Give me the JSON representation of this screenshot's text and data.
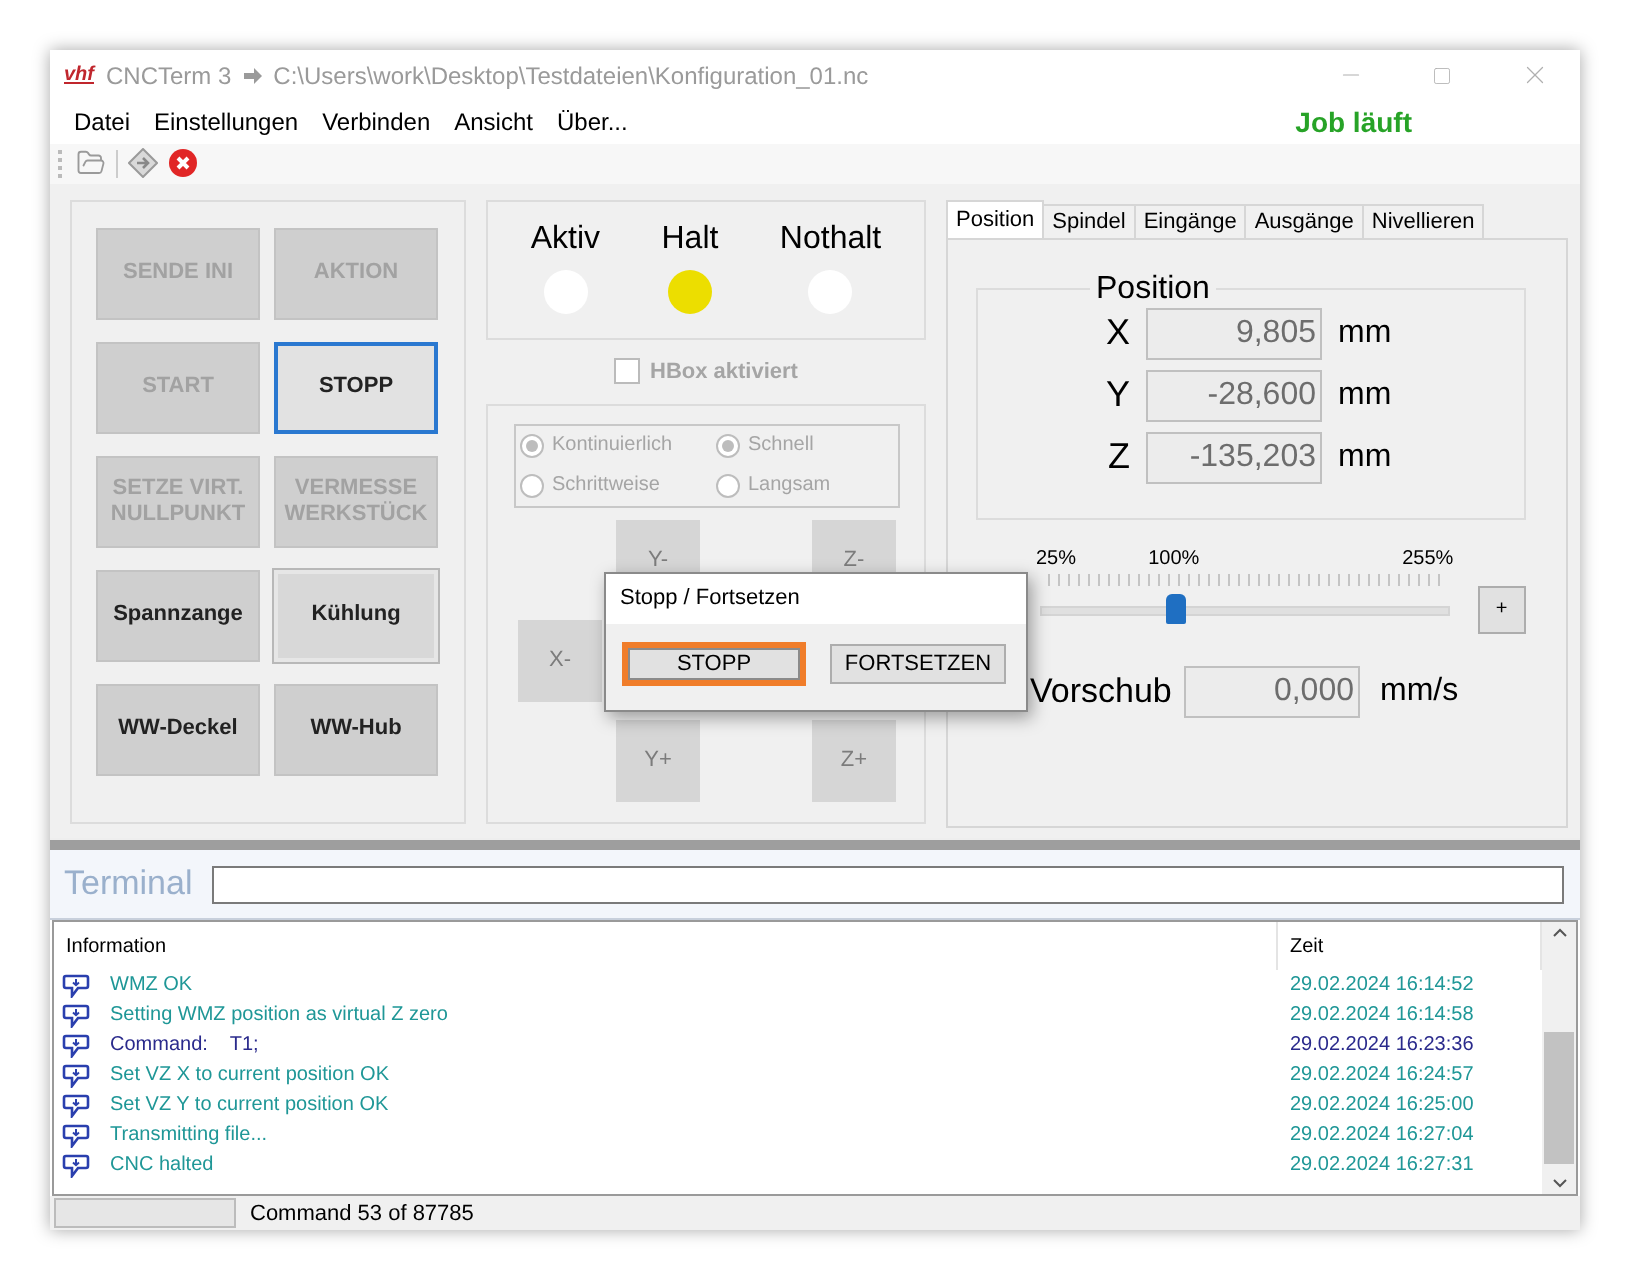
{
  "window": {
    "logo": "vhf",
    "title": "CNCTerm 3",
    "path": "C:\\Users\\work\\Desktop\\Testdateien\\Konfiguration_01.nc"
  },
  "menu": [
    "Datei",
    "Einstellungen",
    "Verbinden",
    "Ansicht",
    "Über..."
  ],
  "job_status": "Job läuft",
  "control_buttons": [
    {
      "label": "SENDE INI",
      "disabled": true,
      "focused": false,
      "checked": false
    },
    {
      "label": "AKTION",
      "disabled": true,
      "focused": false,
      "checked": false
    },
    {
      "label": "START",
      "disabled": true,
      "focused": false,
      "checked": false
    },
    {
      "label": "STOPP",
      "disabled": false,
      "focused": true,
      "checked": false
    },
    {
      "label": "SETZE VIRT. NULLPUNKT",
      "disabled": true,
      "focused": false,
      "checked": false
    },
    {
      "label": "VERMESSE WERKSTÜCK",
      "disabled": true,
      "focused": false,
      "checked": false
    },
    {
      "label": "Spannzange",
      "disabled": false,
      "focused": false,
      "checked": false
    },
    {
      "label": "Kühlung",
      "disabled": false,
      "focused": false,
      "checked": true
    },
    {
      "label": "WW-Deckel",
      "disabled": false,
      "focused": false,
      "checked": false
    },
    {
      "label": "WW-Hub",
      "disabled": false,
      "focused": false,
      "checked": false
    }
  ],
  "indicators": [
    {
      "label": "Aktiv",
      "lit": false
    },
    {
      "label": "Halt",
      "lit": true
    },
    {
      "label": "Nothalt",
      "lit": false
    }
  ],
  "hbox": {
    "label": "HBox aktiviert",
    "checked": false,
    "disabled": true
  },
  "jog": {
    "mode_options": [
      {
        "label": "Kontinuierlich",
        "selected": true
      },
      {
        "label": "Schrittweise",
        "selected": false
      }
    ],
    "speed_options": [
      {
        "label": "Schnell",
        "selected": true
      },
      {
        "label": "Langsam",
        "selected": false
      }
    ],
    "buttons": [
      "Y-",
      "Z-",
      "X-",
      "Y+",
      "Z+"
    ],
    "disabled": true
  },
  "dialog": {
    "title": "Stopp / Fortsetzen",
    "buttons": [
      {
        "label": "STOPP",
        "focused": true
      },
      {
        "label": "FORTSETZEN",
        "focused": false
      }
    ]
  },
  "tabs": [
    {
      "label": "Position",
      "selected": true
    },
    {
      "label": "Spindel",
      "selected": false
    },
    {
      "label": "Eingänge",
      "selected": false
    },
    {
      "label": "Ausgänge",
      "selected": false
    },
    {
      "label": "Nivellieren",
      "selected": false
    }
  ],
  "position": {
    "title": "Position",
    "axes": [
      {
        "axis": "X",
        "value": "9,805",
        "unit": "mm"
      },
      {
        "axis": "Y",
        "value": "-28,600",
        "unit": "mm"
      },
      {
        "axis": "Z",
        "value": "-135,203",
        "unit": "mm"
      }
    ]
  },
  "override": {
    "ticks": [
      "25%",
      "100%",
      "255%"
    ],
    "level": 0.33,
    "button": "+"
  },
  "feed": {
    "label": "Vorschub",
    "value": "0,000",
    "unit": "mm/s"
  },
  "terminal": {
    "label": "Terminal"
  },
  "log": {
    "columns": [
      "Information",
      "Zeit"
    ],
    "rows": [
      {
        "kind": "info",
        "text": "WMZ OK",
        "time": "29.02.2024 16:14:52"
      },
      {
        "kind": "info",
        "text": "Setting WMZ position as virtual Z zero",
        "time": "29.02.2024 16:14:58"
      },
      {
        "kind": "command",
        "text": "Command:    T1;",
        "time": "29.02.2024 16:23:36"
      },
      {
        "kind": "info",
        "text": "Set VZ X to current position OK",
        "time": "29.02.2024 16:24:57"
      },
      {
        "kind": "info",
        "text": "Set VZ Y to current position OK",
        "time": "29.02.2024 16:25:00"
      },
      {
        "kind": "info",
        "text": "Transmitting file...",
        "time": "29.02.2024 16:27:04"
      },
      {
        "kind": "info",
        "text": "CNC halted",
        "time": "29.02.2024 16:27:31"
      }
    ]
  },
  "status_bar": {
    "text": "Command 53 of 87785"
  }
}
